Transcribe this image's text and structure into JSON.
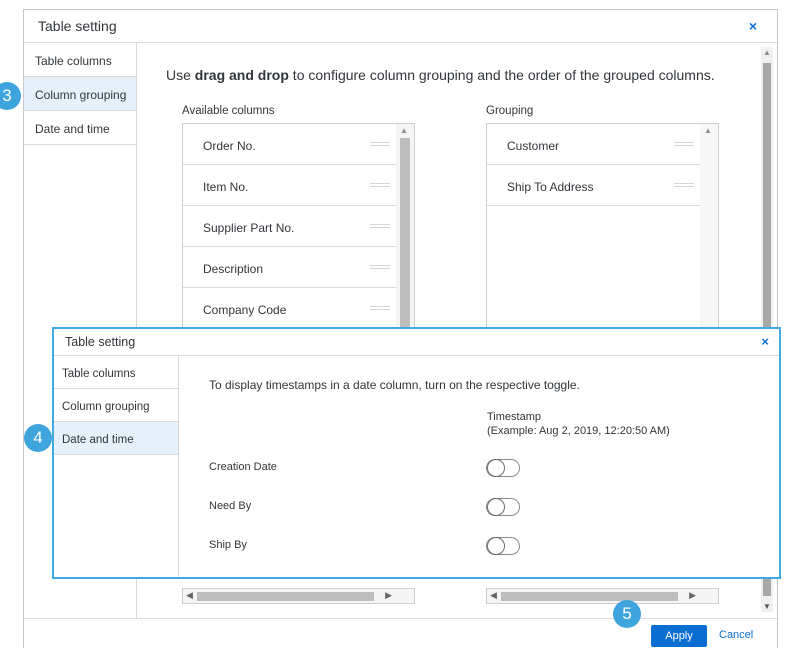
{
  "dialog1": {
    "title": "Table setting",
    "close_glyph": "×",
    "sidebar": [
      "Table columns",
      "Column grouping",
      "Date and time"
    ],
    "active_index": 1,
    "instruction_pre": "Use ",
    "instruction_bold": "drag and drop",
    "instruction_post": " to configure column grouping and the order of the grouped columns.",
    "available_header": "Available columns",
    "grouping_header": "Grouping",
    "available_columns": [
      "Order No.",
      "Item No.",
      "Supplier Part No.",
      "Description",
      "Company Code"
    ],
    "grouping_columns": [
      "Customer",
      "Ship To Address"
    ],
    "apply_label": "Apply",
    "cancel_label": "Cancel"
  },
  "dialog2": {
    "title": "Table setting",
    "close_glyph": "×",
    "sidebar": [
      "Table columns",
      "Column grouping",
      "Date and time"
    ],
    "active_index": 2,
    "instruction": "To display timestamps in a date column, turn on the respective toggle.",
    "timestamp_header": "Timestamp",
    "timestamp_example": "(Example: Aug 2, 2019, 12:20:50 AM)",
    "rows": [
      {
        "label": "Creation Date",
        "on": false
      },
      {
        "label": "Need By",
        "on": false
      },
      {
        "label": "Ship By",
        "on": false
      }
    ]
  },
  "badges": [
    "3",
    "4",
    "5"
  ],
  "colors": {
    "accent": "#0a6ed1",
    "badge": "#3ea4dd",
    "active_bg": "#e5f0fa",
    "highlight_border": "#40a9df"
  }
}
